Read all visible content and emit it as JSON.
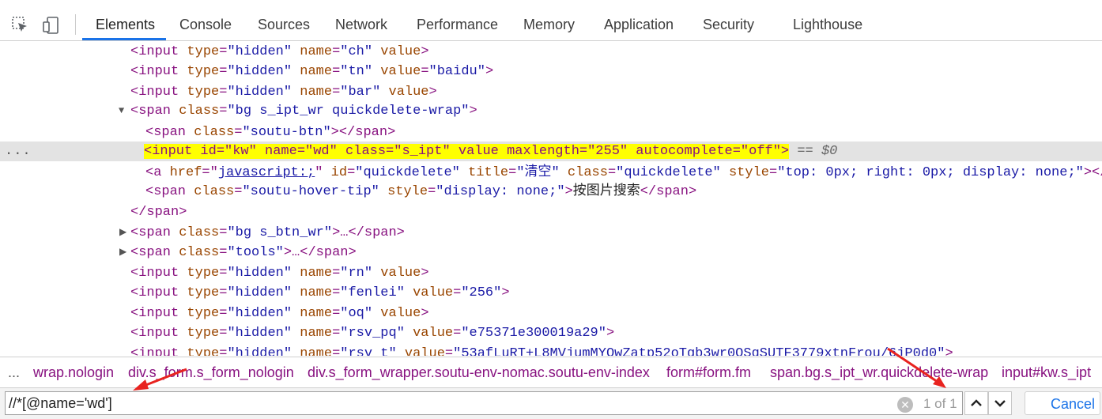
{
  "toolbar": {
    "tabs": [
      {
        "label": "Elements"
      },
      {
        "label": "Console"
      },
      {
        "label": "Sources"
      },
      {
        "label": "Network"
      },
      {
        "label": "Performance"
      },
      {
        "label": "Memory"
      },
      {
        "label": "Application"
      },
      {
        "label": "Security"
      },
      {
        "label": "Lighthouse"
      }
    ],
    "active_tab": "Elements",
    "accent": "#1a73e8"
  },
  "tree": {
    "l1": {
      "open": "<input",
      "a1": "type",
      "v1": "\"hidden\"",
      "a2": "name",
      "v2": "\"ch\"",
      "a3": "value",
      "close": ">"
    },
    "l2": {
      "open": "<input",
      "a1": "type",
      "v1": "\"hidden\"",
      "a2": "name",
      "v2": "\"tn\"",
      "a3": "value",
      "v3": "\"baidu\"",
      "close": ">"
    },
    "l3": {
      "open": "<input",
      "a1": "type",
      "v1": "\"hidden\"",
      "a2": "name",
      "v2": "\"bar\"",
      "a3": "value",
      "close": ">"
    },
    "l4": {
      "open": "<span",
      "a1": "class",
      "v1": "\"bg s_ipt_wr quickdelete-wrap\"",
      "close": ">"
    },
    "l5": {
      "open": "<span",
      "a1": "class",
      "v1": "\"soutu-btn\"",
      "close": "></span>"
    },
    "l6": {
      "text": "<input id=\"kw\" name=\"wd\" class=\"s_ipt\" value maxlength=\"255\" autocomplete=\"off\">",
      "eq": "== $0"
    },
    "l7": {
      "open": "<a",
      "a1": "href",
      "v1": "javascript:;",
      "a2": "id",
      "v2": "\"quickdelete\"",
      "a3": "title",
      "v3": "\"清空\"",
      "a4": "class",
      "v4": "\"quickdelete\"",
      "a5": "style",
      "v5": "\"top: 0px; right: 0px; display: none;\"",
      "close": "></a>"
    },
    "l8": {
      "open": "<span",
      "a1": "class",
      "v1": "\"soutu-hover-tip\"",
      "a2": "style",
      "v2": "\"display: none;\"",
      "text": "按图片搜索",
      "close": "</span>"
    },
    "l9": {
      "close": "</span>"
    },
    "l10": {
      "open": "<span",
      "a1": "class",
      "v1": "\"bg s_btn_wr\"",
      "close": ">…</span>"
    },
    "l11": {
      "open": "<span",
      "a1": "class",
      "v1": "\"tools\"",
      "close": ">…</span>"
    },
    "l12": {
      "open": "<input",
      "a1": "type",
      "v1": "\"hidden\"",
      "a2": "name",
      "v2": "\"rn\"",
      "a3": "value",
      "close": ">"
    },
    "l13": {
      "open": "<input",
      "a1": "type",
      "v1": "\"hidden\"",
      "a2": "name",
      "v2": "\"fenlei\"",
      "a3": "value",
      "v3": "\"256\"",
      "close": ">"
    },
    "l14": {
      "open": "<input",
      "a1": "type",
      "v1": "\"hidden\"",
      "a2": "name",
      "v2": "\"oq\"",
      "a3": "value",
      "close": ">"
    },
    "l15": {
      "open": "<input",
      "a1": "type",
      "v1": "\"hidden\"",
      "a2": "name",
      "v2": "\"rsv_pq\"",
      "a3": "value",
      "v3": "\"e75371e300019a29\"",
      "close": ">"
    },
    "l16": {
      "open": "<input",
      "a1": "type",
      "v1": "\"hidden\"",
      "a2": "name",
      "v2": "\"rsv_t\"",
      "a3": "value",
      "v3": "\"53afLuRT+L8MVjumMYOwZatp52oTgb3wr0OSqSUTF3779xtnFrou/6jP0d0\"",
      "close": ">"
    },
    "more": "..."
  },
  "breadcrumbs": {
    "more": "...",
    "items": [
      "wrap.nologin",
      "div.s_form.s_form_nologin",
      "div.s_form_wrapper.soutu-env-nomac.soutu-env-index",
      "form#form.fm",
      "span.bg.s_ipt_wr.quickdelete-wrap",
      "input#kw.s_ipt"
    ]
  },
  "search": {
    "value": "//*[@name='wd']",
    "match_count": "1 of 1",
    "cancel_label": "Cancel"
  },
  "colors": {
    "tag": "#881280",
    "attr": "#994500",
    "value": "#1a1aa6",
    "highlight": "#ffff00",
    "annotation_arrow": "#e8231f"
  }
}
